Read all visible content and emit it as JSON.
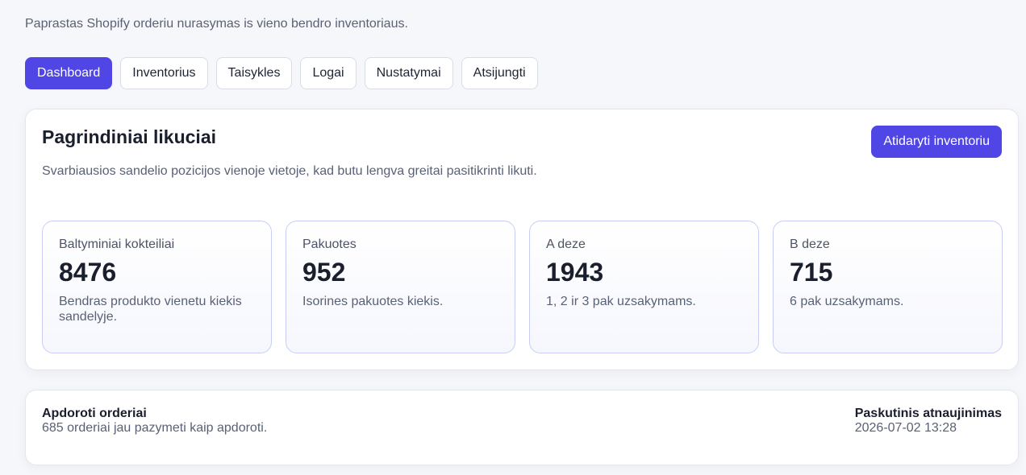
{
  "header": {
    "subtitle": "Paprastas Shopify orderiu nurasymas is vieno bendro inventoriaus."
  },
  "nav": {
    "items": [
      {
        "label": "Dashboard",
        "active": true
      },
      {
        "label": "Inventorius",
        "active": false
      },
      {
        "label": "Taisykles",
        "active": false
      },
      {
        "label": "Logai",
        "active": false
      },
      {
        "label": "Nustatymai",
        "active": false
      },
      {
        "label": "Atsijungti",
        "active": false
      }
    ]
  },
  "main": {
    "title": "Pagrindiniai likuciai",
    "description": "Svarbiausios sandelio pozicijos vienoje vietoje, kad butu lengva greitai pasitikrinti likuti.",
    "open_button": "Atidaryti inventoriu",
    "stats": [
      {
        "label": "Baltyminiai kokteiliai",
        "value": "8476",
        "description": "Bendras produkto vienetu kiekis sandelyje."
      },
      {
        "label": "Pakuotes",
        "value": "952",
        "description": "Isorines pakuotes kiekis."
      },
      {
        "label": "A deze",
        "value": "1943",
        "description": "1, 2 ir 3 pak uzsakymams."
      },
      {
        "label": "B deze",
        "value": "715",
        "description": "6 pak uzsakymams."
      }
    ]
  },
  "footer": {
    "processed_title": "Apdoroti orderiai",
    "processed_text": "685 orderiai jau pazymeti kaip apdoroti.",
    "updated_title": "Paskutinis atnaujinimas",
    "updated_text": "2026-07-02 13:28"
  },
  "colors": {
    "accent": "#4f46e5",
    "background": "#f6f7fb"
  }
}
